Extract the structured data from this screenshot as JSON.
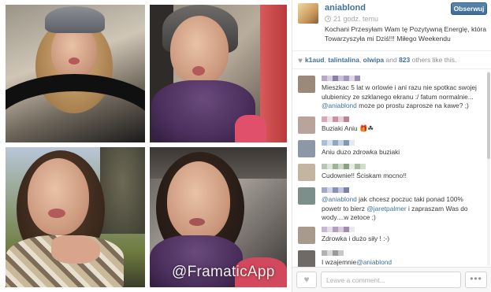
{
  "collage": {
    "watermark": "@FramaticApp"
  },
  "post": {
    "author": "aniablond",
    "time": "21 godz. temu",
    "follow_label": "Obserwuj",
    "caption": "Kochani Przesyłam Wam tę Pozytywną Energię, która Towarzyszyła mi Dziś!!! Miłego Weekendu"
  },
  "likes": {
    "likers": [
      "k1aud",
      "talintalina",
      "olwipa"
    ],
    "and_text": "and",
    "others_count": "823",
    "suffix": "others like this."
  },
  "comments": [
    {
      "avatar_color": "#9b8a7a",
      "text_before": "Mieszkac 5 lat w orlowie i ani razu nie spotkac swojej ulubienicy ze szklanego ekranu :/ fatum normalnie... ",
      "mention": "@aniablond",
      "text_after": " moze po prostu zaprosze na kawe? ;)"
    },
    {
      "avatar_color": "#b8a49a",
      "text_before": "Buziaki Aniu ",
      "mention": "",
      "text_after": "🎁☘"
    },
    {
      "avatar_color": "#8c98a6",
      "text_before": "Aniu duzo zdrowka buziaki",
      "mention": "",
      "text_after": ""
    },
    {
      "avatar_color": "#c4b5a3",
      "text_before": "Cudownie!! Ściskam mocno!!",
      "mention": "",
      "text_after": ""
    },
    {
      "avatar_color": "#7d8f8a",
      "text_before": "",
      "mention": "@aniablond",
      "text_after": " jak chcesz poczuc taki ponad 100% powetr to bierz ",
      "mention2": "@jaretpalmer",
      "text_after2": " i zapraszam Was do wody....w zetoce ;)"
    },
    {
      "avatar_color": "#a89b8e",
      "text_before": "Zdrowka i dużo siły ! :-)",
      "mention": "",
      "text_after": ""
    },
    {
      "avatar_color": "#6f6a66",
      "text_before": "I wzajemnie",
      "mention": "@aniablond",
      "text_after": ""
    }
  ],
  "footer": {
    "comment_placeholder": "Leave a comment...",
    "more_label": "•••"
  },
  "colors": {
    "link": "#3f729b",
    "follow_button": "#4a77a6",
    "meta_grey": "#a5a7aa"
  }
}
